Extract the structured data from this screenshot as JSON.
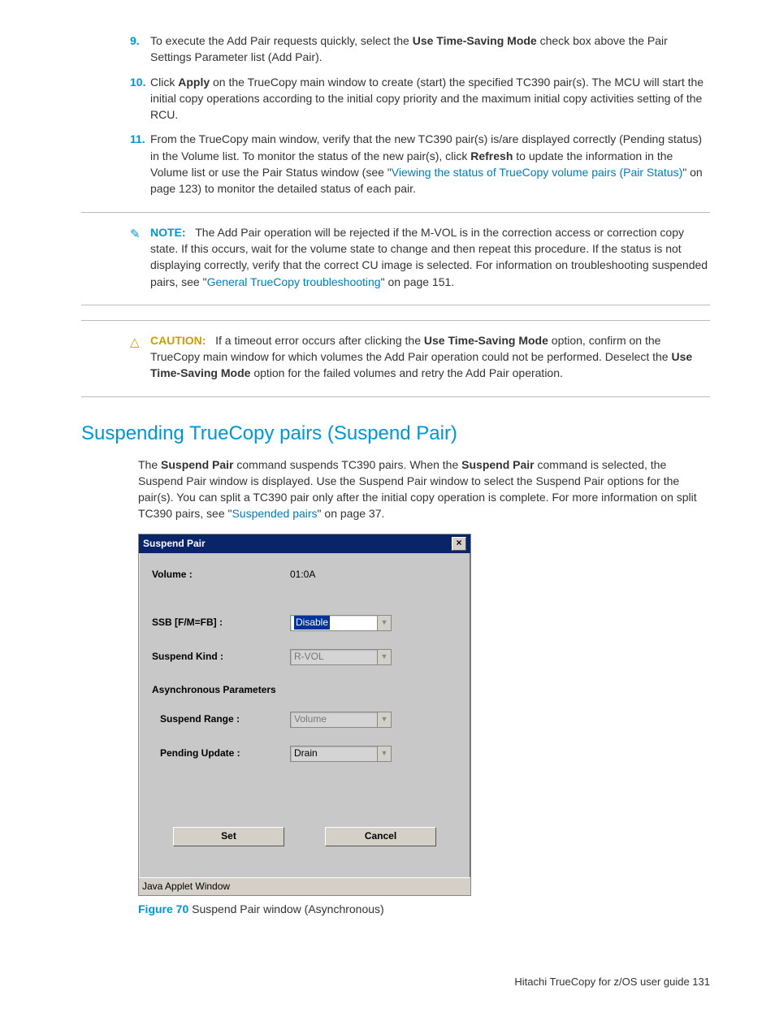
{
  "steps": {
    "s9": {
      "num": "9.",
      "pre": "To execute the Add Pair requests quickly, select the ",
      "bold1": "Use Time-Saving Mode",
      "post": " check box above the Pair Settings Parameter list (Add Pair)."
    },
    "s10": {
      "num": "10.",
      "pre": "Click ",
      "bold1": "Apply",
      "post": " on the TrueCopy main window to create (start) the specified TC390 pair(s). The MCU will start the initial copy operations according to the initial copy priority and the maximum initial copy activities setting of the RCU."
    },
    "s11": {
      "num": "11.",
      "pre": "From the TrueCopy main window, verify that the new TC390 pair(s) is/are displayed correctly (Pending status) in the Volume list. To monitor the status of the new pair(s), click ",
      "bold1": "Refresh",
      "mid": " to update the information in the Volume list or use the Pair Status window (see \"",
      "link": "Viewing the status of TrueCopy volume pairs (Pair Status)",
      "post": "\" on page 123) to monitor the detailed status of each pair."
    }
  },
  "note": {
    "label": "NOTE:",
    "text_pre": "The Add Pair operation will be rejected if the M-VOL is in the correction access or correction copy state. If this occurs, wait for the volume state to change and then repeat this procedure. If the status is not displaying correctly, verify that the correct CU image is selected. For information on troubleshooting suspended pairs, see \"",
    "link": "General TrueCopy troubleshooting",
    "text_post": "\" on page 151."
  },
  "caution": {
    "label": "CAUTION:",
    "pre": "If a timeout error occurs after clicking the ",
    "bold1": "Use Time-Saving Mode",
    "mid": " option, confirm on the TrueCopy main window for which volumes the Add Pair operation could not be performed. Deselect the ",
    "bold2": "Use Time-Saving Mode",
    "post": " option for the failed volumes and retry the Add Pair operation."
  },
  "heading": "Suspending TrueCopy pairs (Suspend Pair)",
  "intro": {
    "pre": "The ",
    "b1": "Suspend Pair",
    "mid1": " command suspends TC390 pairs. When the ",
    "b2": "Suspend Pair",
    "mid2": " command is selected, the Suspend Pair window is displayed. Use the Suspend Pair window to select the Suspend Pair options for the pair(s). You can split a TC390 pair only after the initial copy operation is complete. For more information on split TC390 pairs, see \"",
    "link": "Suspended pairs",
    "post": "\" on page 37."
  },
  "dialog": {
    "title": "Suspend Pair",
    "volume_label": "Volume :",
    "volume_value": "01:0A",
    "ssb_label": "SSB [F/M=FB] :",
    "ssb_value": "Disable",
    "kind_label": "Suspend Kind :",
    "kind_value": "R-VOL",
    "async_header": "Asynchronous Parameters",
    "range_label": "Suspend Range :",
    "range_value": "Volume",
    "pending_label": "Pending Update :",
    "pending_value": "Drain",
    "btn_set": "Set",
    "btn_cancel": "Cancel",
    "status": "Java Applet Window"
  },
  "figure": {
    "label": "Figure 70",
    "text": " Suspend Pair window (Asynchronous)"
  },
  "footer": "Hitachi TrueCopy for z/OS user guide   131"
}
